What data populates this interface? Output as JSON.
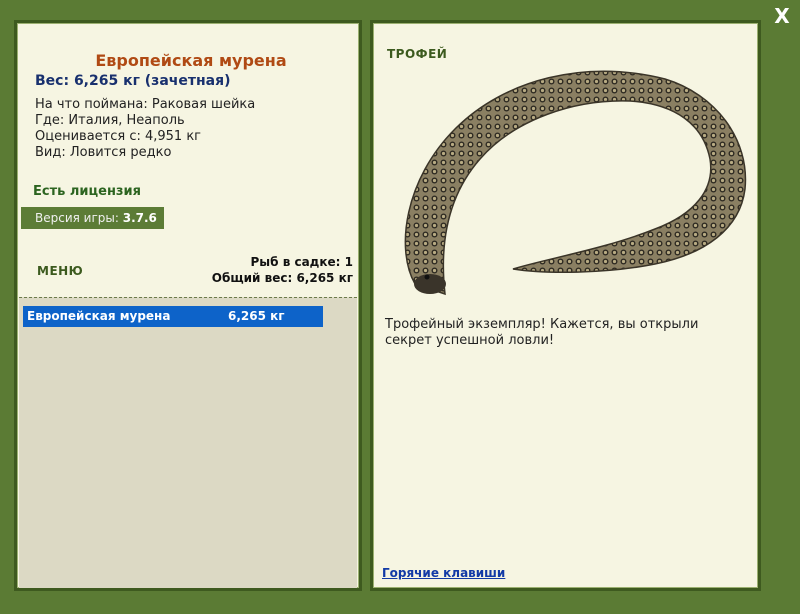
{
  "window": {
    "close_label": "X"
  },
  "fish": {
    "name": "Европейская мурена",
    "weight_line": "Вес: 6,265 кг (зачетная)",
    "bait": "На что поймана: Раковая шейка",
    "location": "Где: Италия, Неаполь",
    "valued_from": "Оценивается с: 4,951 кг",
    "rarity": "Вид: Ловится редко"
  },
  "license": "Есть лицензия",
  "version": {
    "label": "Версия игры:",
    "value": "3.7.6"
  },
  "menu_label": "МЕНЮ",
  "keep": {
    "count_text": "Рыб в садке: 1",
    "total_weight_text": "Общий вес: 6,265 кг"
  },
  "catch_list": [
    {
      "name": "Европейская мурена",
      "weight": "6,265 кг"
    }
  ],
  "trophy": {
    "label": "ТРОФЕЙ",
    "text": "Трофейный экземпляр! Кажется, вы открыли секрет успешной ловли!"
  },
  "hotkeys_link": "Горячие клавиши",
  "colors": {
    "background": "#5b7b34",
    "panel": "#f6f5e2",
    "title": "#b04a14",
    "weight": "#18306e",
    "selection": "#0d63c9"
  }
}
